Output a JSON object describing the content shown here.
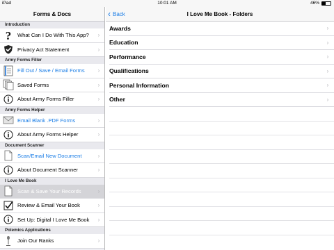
{
  "status_bar": {
    "device": "iPad",
    "time": "10:01 AM",
    "battery": "46%"
  },
  "master": {
    "title": "Forms & Docs",
    "sections": [
      {
        "header": "Introduction",
        "rows": [
          {
            "label": "What Can I Do With This App?",
            "icon": "question-icon",
            "style": "normal"
          },
          {
            "label": "Privacy Act Statement",
            "icon": "shield-icon",
            "style": "normal"
          }
        ]
      },
      {
        "header": "Army Forms Filler",
        "rows": [
          {
            "label": "Fill Out / Save / Email Forms",
            "icon": "form-icon",
            "style": "blue"
          },
          {
            "label": "Saved Forms",
            "icon": "documents-icon",
            "style": "normal"
          },
          {
            "label": "About Army Forms Filler",
            "icon": "info-icon",
            "style": "normal"
          }
        ]
      },
      {
        "header": "Army Forms Helper",
        "rows": [
          {
            "label": "Email Blank .PDF Forms",
            "icon": "envelope-icon",
            "style": "blue"
          },
          {
            "label": "About Army Forms Helper",
            "icon": "info-icon",
            "style": "normal"
          }
        ]
      },
      {
        "header": "Document Scanner",
        "rows": [
          {
            "label": "Scan/Email New Document",
            "icon": "document-icon",
            "style": "blue"
          },
          {
            "label": "About Document Scanner",
            "icon": "info-icon",
            "style": "normal"
          }
        ]
      },
      {
        "header": "I Love Me Book",
        "rows": [
          {
            "label": "Scan & Save Your Records",
            "icon": "document-icon",
            "style": "selected"
          },
          {
            "label": "Review & Email Your Book",
            "icon": "checkbox-icon",
            "style": "normal"
          },
          {
            "label": "Set Up: Digital I Love Me Book",
            "icon": "info-icon",
            "style": "normal"
          }
        ]
      },
      {
        "header": "Polemics Applications",
        "rows": [
          {
            "label": "Join Our Ranks",
            "icon": "microphone-icon",
            "style": "normal"
          }
        ]
      }
    ]
  },
  "detail": {
    "back_label": "Back",
    "title": "I Love Me Book - Folders",
    "folders": [
      "Awards",
      "Education",
      "Performance",
      "Qualifications",
      "Personal Information",
      "Other"
    ],
    "empty_rows": 9
  },
  "colors": {
    "accent": "#1a7de6",
    "selected_row": "#d4d4d8",
    "separator": "#d9d9de"
  }
}
